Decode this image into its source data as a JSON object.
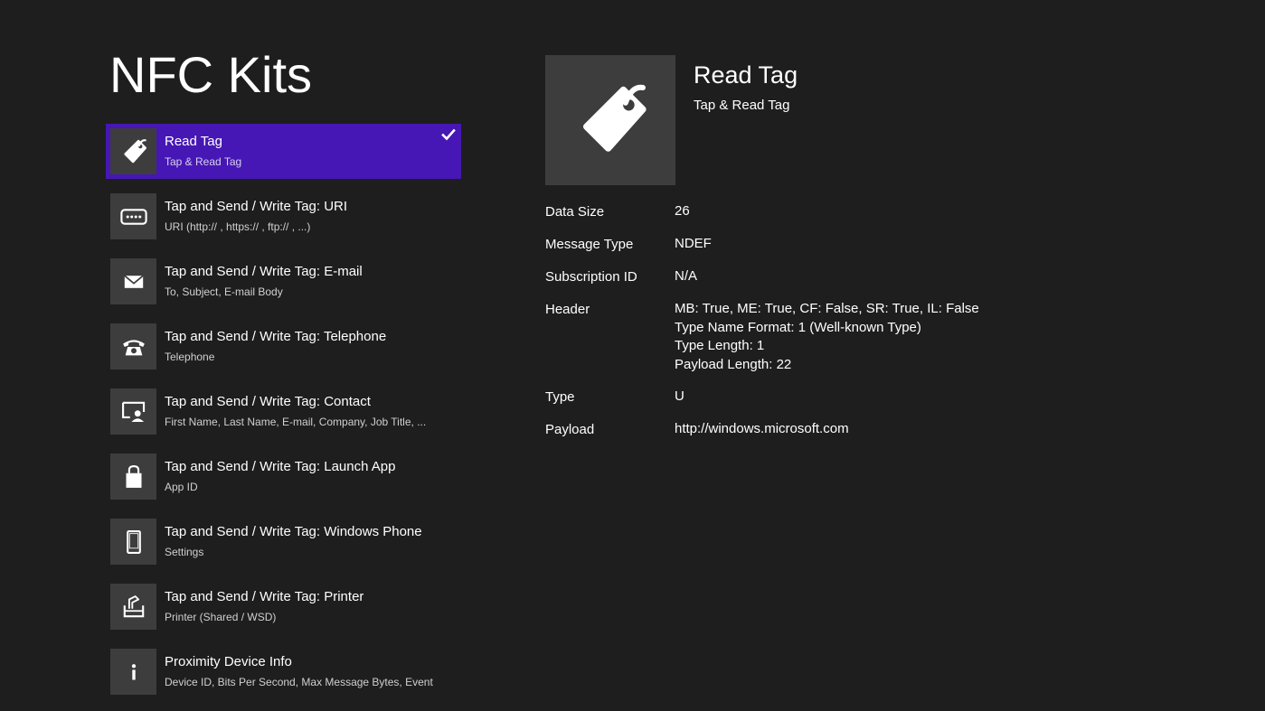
{
  "app": {
    "title": "NFC Kits"
  },
  "colors": {
    "accent": "#4617b4",
    "background": "#1e1e1e",
    "tile": "#3d3d3d"
  },
  "list": [
    {
      "title": "Read Tag",
      "subtitle": "Tap & Read Tag",
      "icon": "tag-icon",
      "selected": true
    },
    {
      "title": "Tap and Send / Write Tag: URI",
      "subtitle": "URI (http:// , https:// , ftp:// , ...)",
      "icon": "uri-icon"
    },
    {
      "title": "Tap and Send / Write Tag: E-mail",
      "subtitle": "To, Subject, E-mail Body",
      "icon": "mail-icon"
    },
    {
      "title": "Tap and Send / Write Tag: Telephone",
      "subtitle": "Telephone",
      "icon": "telephone-icon"
    },
    {
      "title": "Tap and Send / Write Tag: Contact",
      "subtitle": "First Name, Last Name, E-mail, Company, Job Title, ...",
      "icon": "contact-icon"
    },
    {
      "title": "Tap and Send / Write Tag: Launch App",
      "subtitle": "App ID",
      "icon": "store-bag-icon"
    },
    {
      "title": "Tap and Send / Write Tag: Windows Phone",
      "subtitle": "Settings",
      "icon": "phone-icon"
    },
    {
      "title": "Tap and Send / Write Tag: Printer",
      "subtitle": "Printer (Shared / WSD)",
      "icon": "printer-icon"
    },
    {
      "title": "Proximity Device Info",
      "subtitle": "Device ID, Bits Per Second, Max Message Bytes, Event",
      "icon": "info-icon"
    }
  ],
  "detail": {
    "title": "Read Tag",
    "subtitle": "Tap & Read Tag",
    "icon": "tag-icon",
    "properties": [
      {
        "label": "Data Size",
        "value": [
          "26"
        ]
      },
      {
        "label": "Message Type",
        "value": [
          "NDEF"
        ]
      },
      {
        "label": "Subscription ID",
        "value": [
          "N/A"
        ]
      },
      {
        "label": "Header",
        "value": [
          "MB: True, ME: True, CF: False, SR: True, IL: False",
          "Type Name Format: 1 (Well-known Type)",
          "Type Length: 1",
          "Payload Length: 22"
        ]
      },
      {
        "label": "Type",
        "value": [
          "U"
        ]
      },
      {
        "label": "Payload",
        "value": [
          "http://windows.microsoft.com"
        ]
      }
    ]
  }
}
